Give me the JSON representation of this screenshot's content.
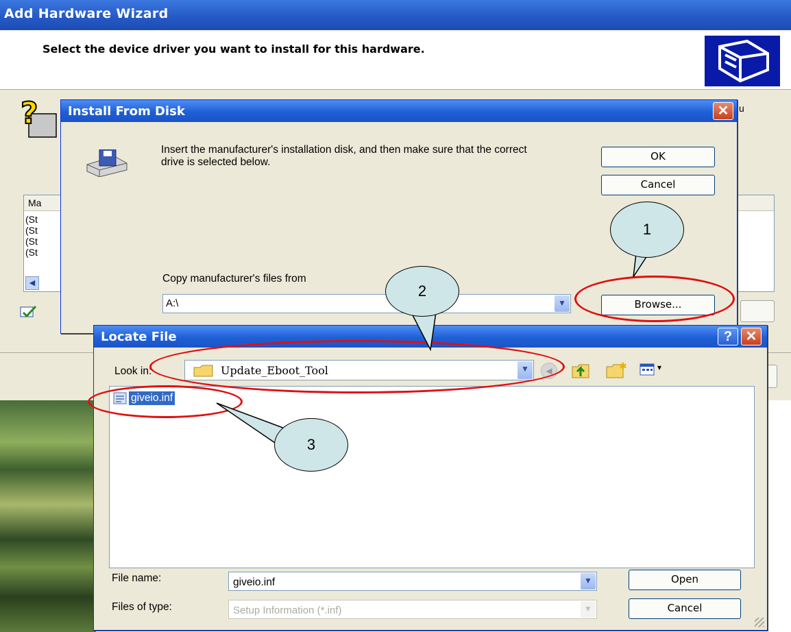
{
  "wizard": {
    "title": "Add Hardware Wizard",
    "header_text": "Select the device driver you want to install for this hardware.",
    "list_header_partial": "Ma",
    "list_rows_partial": [
      "(St",
      "(St",
      "(St",
      "(St"
    ],
    "right_clip_text": "u"
  },
  "install_dialog": {
    "title": "Install From Disk",
    "message": "Insert the manufacturer's installation disk, and then make sure that the correct drive is selected below.",
    "ok_label": "OK",
    "cancel_label": "Cancel",
    "copy_label": "Copy manufacturer's files from",
    "path_value": "A:\\",
    "browse_label": "Browse..."
  },
  "locate_dialog": {
    "title": "Locate File",
    "look_in_label": "Look in:",
    "look_in_value": "Update_Eboot_Tool",
    "files": [
      {
        "name": "giveio.inf",
        "selected": true
      }
    ],
    "file_name_label": "File name:",
    "file_name_value": "giveio.inf",
    "files_of_type_label": "Files of type:",
    "files_of_type_value": "Setup Information (*.inf)",
    "open_label": "Open",
    "cancel_label": "Cancel"
  },
  "callouts": [
    {
      "number": "1"
    },
    {
      "number": "2"
    },
    {
      "number": "3"
    }
  ],
  "colors": {
    "titlebar": "#2458c4",
    "dialog_bg": "#ece9d8",
    "highlight_ring": "#e01010",
    "callout_fill": "#cfe6e8",
    "selection": "#316ac5"
  }
}
